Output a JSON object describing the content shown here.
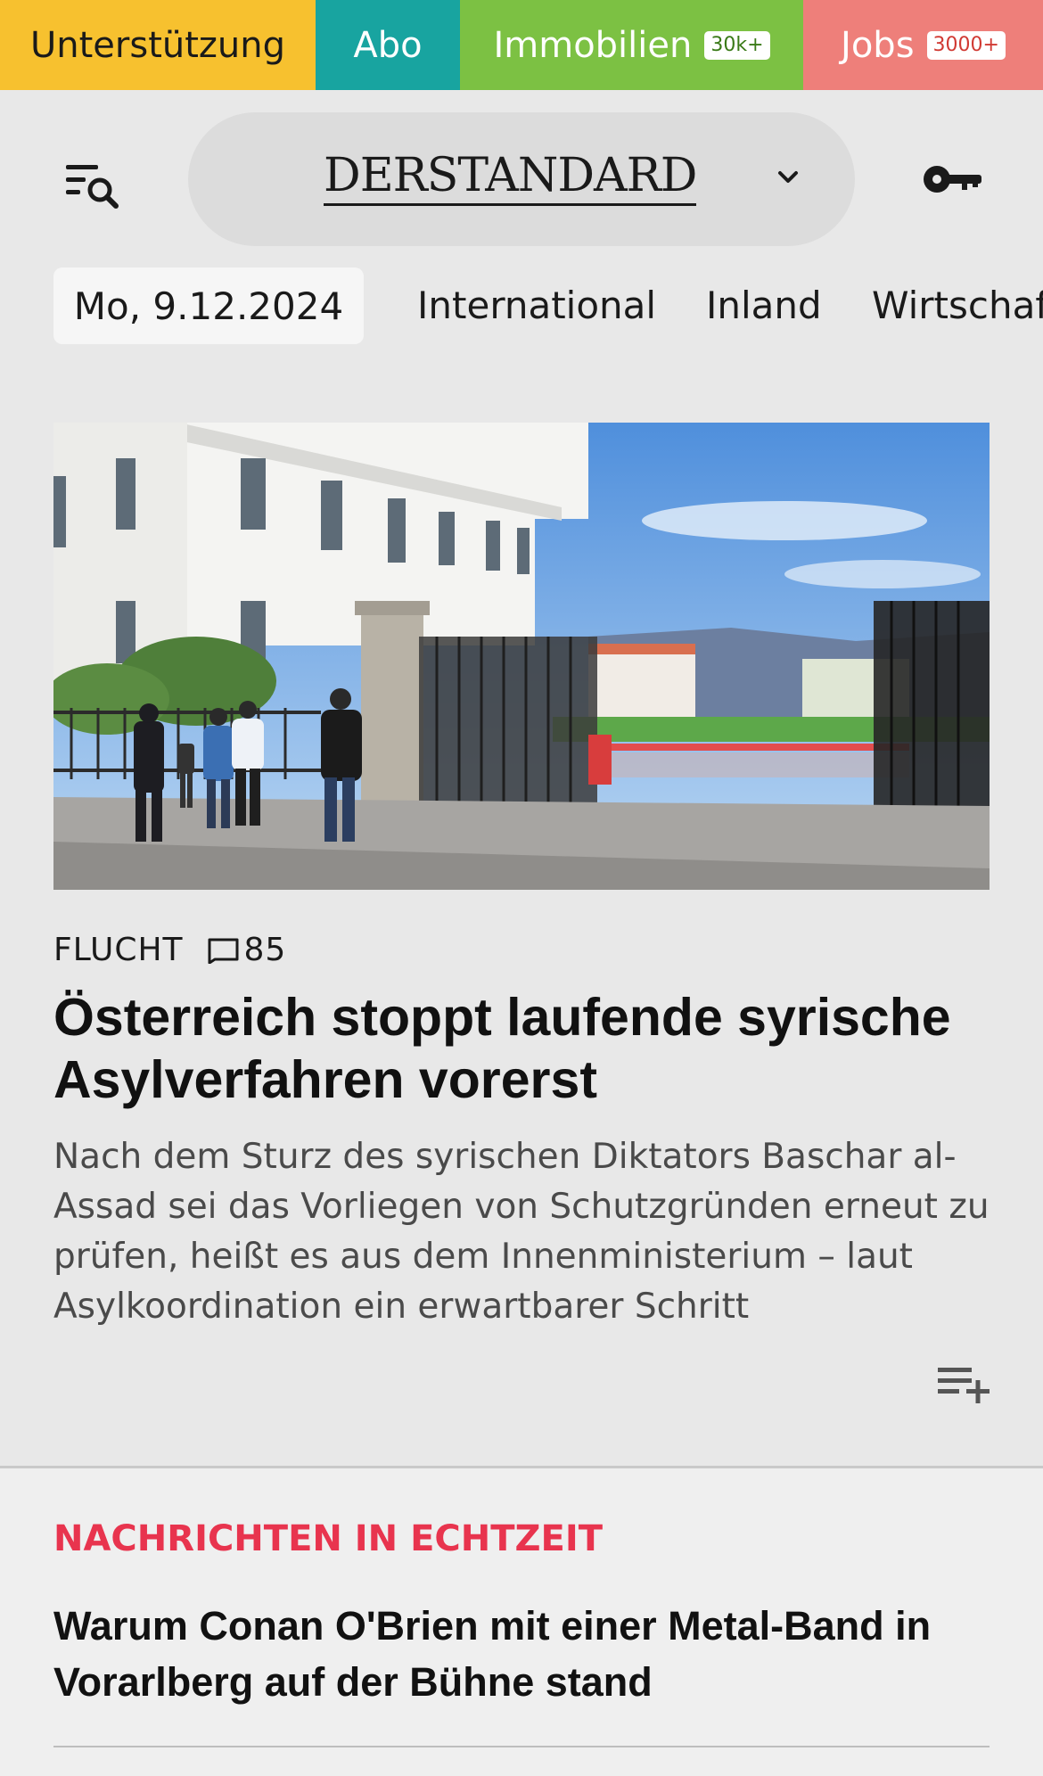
{
  "topbar": {
    "support_label": "Unterstützung",
    "abo_label": "Abo",
    "immobilien_label": "Immobilien",
    "immobilien_badge": "30k+",
    "jobs_label": "Jobs",
    "jobs_badge": "3000+",
    "colors": {
      "support": "#f7c12f",
      "abo": "#18a4a0",
      "immobilien": "#7cc143",
      "jobs": "#ee7f7a"
    }
  },
  "header": {
    "logo_text": "DERSTANDARD",
    "menu_icon": "menu-search-icon",
    "logo_dropdown_icon": "chevron-down-icon",
    "login_icon": "key-icon"
  },
  "nav": {
    "date": "Mo, 9.12.2024",
    "items": [
      "International",
      "Inland",
      "Wirtschaf"
    ]
  },
  "lead": {
    "kicker": "FLUCHT",
    "comment_count": "85",
    "title": "Österreich stoppt laufende syrische Asylverfahren vorerst",
    "teaser": "Nach dem Sturz des syrischen Diktators Baschar al-Assad sei das Vorliegen von Schutzgründen erneut zu prüfen, heißt es aus dem Innenministerium – laut Asylkoordination ein erwartbarer Schritt",
    "image_icon": "article-photo",
    "add_icon": "playlist-add-icon"
  },
  "live": {
    "label": "NACHRICHTEN IN ECHTZEIT",
    "label_color": "#e8344e",
    "headline": "Warum Conan O'Brien mit einer Metal-Band in Vorarlberg auf der Bühne stand"
  }
}
